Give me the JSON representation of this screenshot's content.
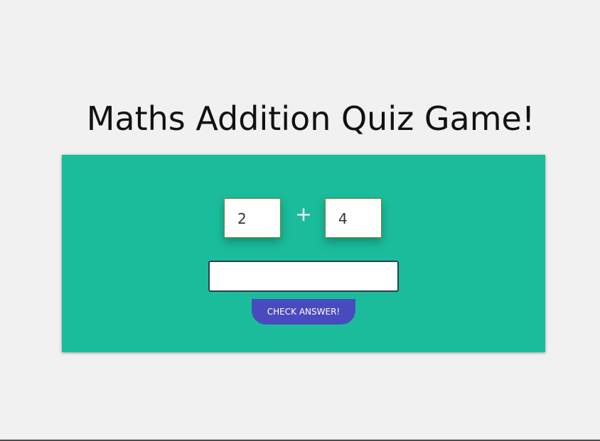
{
  "page": {
    "title": "Maths Addition Quiz Game!"
  },
  "quiz": {
    "first_number": "2",
    "operator": "+",
    "second_number": "4",
    "answer_value": "",
    "answer_placeholder": "",
    "check_button_label": "CHECK ANSWER!"
  },
  "colors": {
    "background": "#f1f1f1",
    "panel": "#1abc9c",
    "button": "#4a4abf",
    "text": "#111111"
  }
}
